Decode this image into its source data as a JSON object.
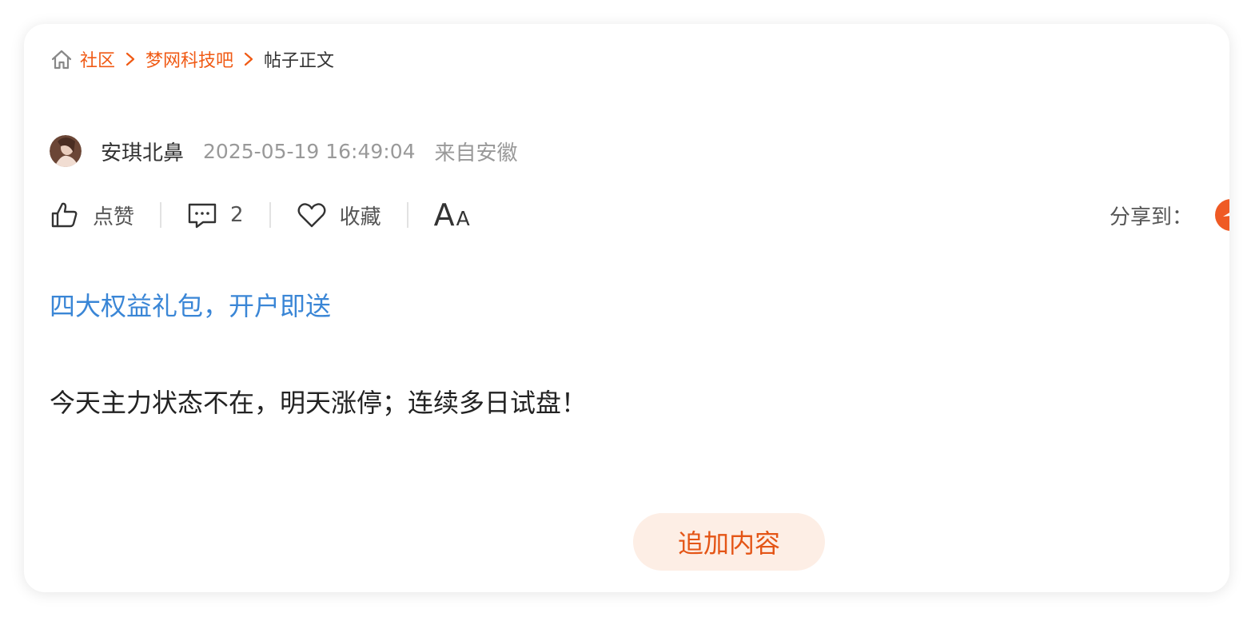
{
  "breadcrumb": {
    "home": "社区",
    "forum": "梦网科技吧",
    "current": "帖子正文"
  },
  "author": {
    "name": "安琪北鼻",
    "time": "2025-05-19 16:49:04",
    "location": "来自安徽"
  },
  "actions": {
    "like_label": "点赞",
    "comment_count": "2",
    "favorite_label": "收藏",
    "font_large": "A",
    "font_small": "A",
    "share_label": "分享到："
  },
  "promo": {
    "link_text": "四大权益礼包，开户即送"
  },
  "post": {
    "body": "今天主力状态不在，明天涨停；连续多日试盘！"
  },
  "append_button": {
    "label": "追加内容"
  },
  "colors": {
    "accent": "#f05a14",
    "link_blue": "#3a86d6",
    "append_bg": "#fdeee5",
    "share_icon": "#ef5a24"
  },
  "icons": {
    "home": "home-icon",
    "like": "thumbs-up-icon",
    "comment": "comment-icon",
    "favorite": "heart-icon",
    "share": "share-icon"
  }
}
